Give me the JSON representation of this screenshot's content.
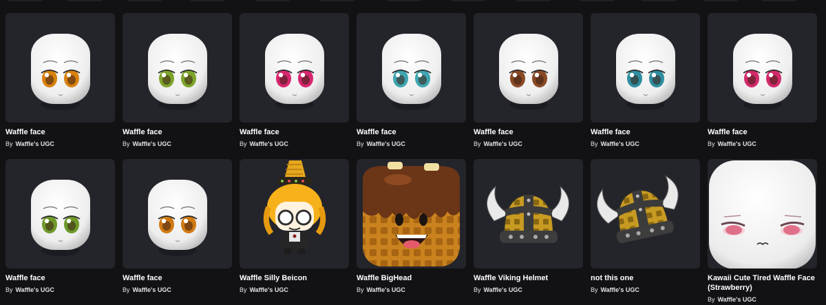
{
  "catalog": {
    "items": [
      {
        "name": "Waffle face",
        "by": "By",
        "creator": "Waffle's UGC",
        "icon": "waffle-face-icon",
        "eye_color": "#d9820f"
      },
      {
        "name": "Waffle face",
        "by": "By",
        "creator": "Waffle's UGC",
        "icon": "waffle-face-icon",
        "eye_color": "#7ea42c"
      },
      {
        "name": "Waffle face",
        "by": "By",
        "creator": "Waffle's UGC",
        "icon": "waffle-face-icon",
        "eye_color": "#d6276f"
      },
      {
        "name": "Waffle face",
        "by": "By",
        "creator": "Waffle's UGC",
        "icon": "waffle-face-icon",
        "eye_color": "#3fa6b2"
      },
      {
        "name": "Waffle face",
        "by": "By",
        "creator": "Waffle's UGC",
        "icon": "waffle-face-icon",
        "eye_color": "#8a4a26"
      },
      {
        "name": "Waffle face",
        "by": "By",
        "creator": "Waffle's UGC",
        "icon": "waffle-face-icon",
        "eye_color": "#2f8ea0"
      },
      {
        "name": "Waffle face",
        "by": "By",
        "creator": "Waffle's UGC",
        "icon": "waffle-face-icon",
        "eye_color": "#d32a6c"
      },
      {
        "name": "Waffle face",
        "by": "By",
        "creator": "Waffle's UGC",
        "icon": "waffle-face-icon",
        "eye_color": "#6f9a2a"
      },
      {
        "name": "Waffle face",
        "by": "By",
        "creator": "Waffle's UGC",
        "icon": "waffle-face-icon",
        "eye_color": "#d17a14"
      },
      {
        "name": "Waffle Silly Beicon",
        "by": "By",
        "creator": "Waffle's UGC",
        "icon": "waffle-beicon-icon"
      },
      {
        "name": "Waffle BigHead",
        "by": "By",
        "creator": "Waffle's UGC",
        "icon": "waffle-bighead-icon"
      },
      {
        "name": "Waffle Viking Helmet",
        "by": "By",
        "creator": "Waffle's UGC",
        "icon": "viking-helmet-icon"
      },
      {
        "name": "not this one",
        "by": "By",
        "creator": "Waffle's UGC",
        "icon": "viking-helmet-tilted-icon"
      },
      {
        "name": "Kawaii Cute Tired Waffle Face (Strawberry)",
        "by": "By",
        "creator": "Waffle's UGC",
        "icon": "kawaii-tired-face-icon",
        "eye_color": "#e0708a"
      }
    ]
  },
  "colors": {
    "background": "#121215",
    "card": "#24252b",
    "text": "#ffffff"
  }
}
